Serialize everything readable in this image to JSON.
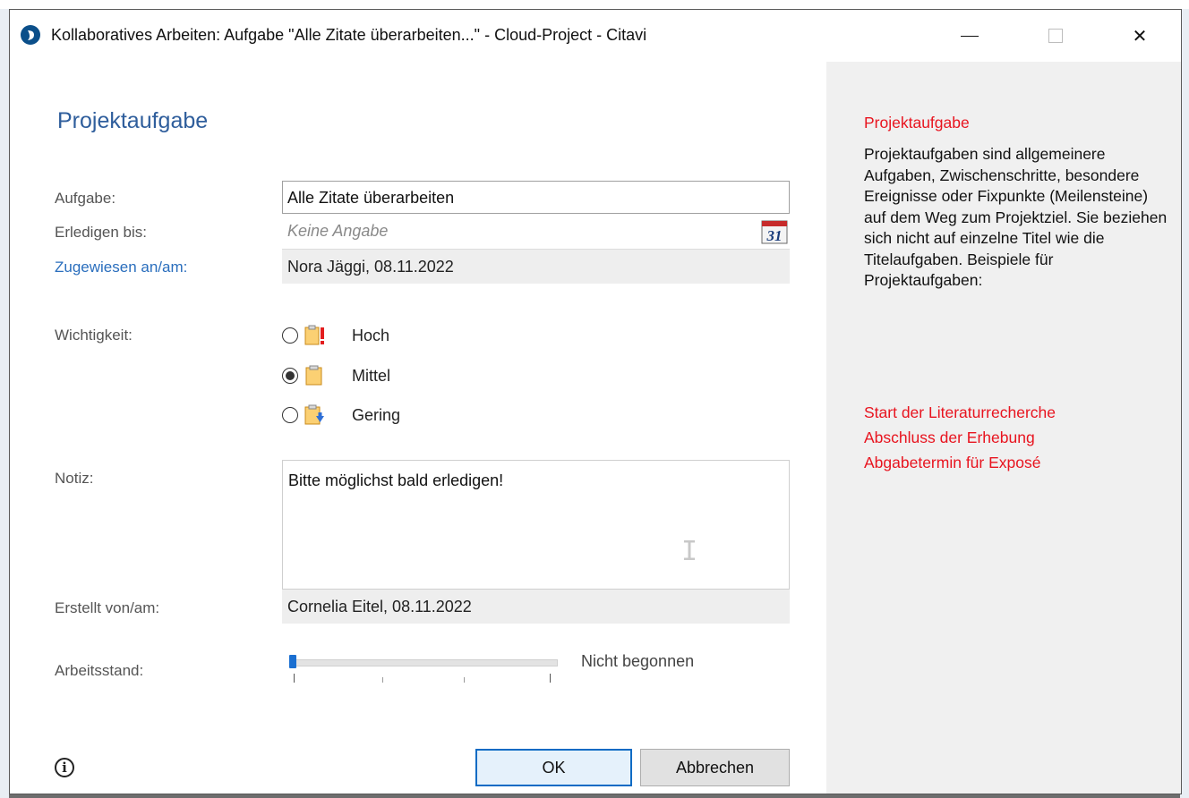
{
  "window": {
    "title": "Kollaboratives Arbeiten: Aufgabe \"Alle Zitate überarbeiten...\" - Cloud-Project - Citavi",
    "minimize_glyph": "—",
    "close_glyph": "✕"
  },
  "form": {
    "heading": "Projektaufgabe",
    "task_label": "Aufgabe:",
    "task_value": "Alle Zitate überarbeiten",
    "due_label": "Erledigen bis:",
    "due_placeholder": "Keine Angabe",
    "calendar_day": "31",
    "assigned_label": "Zugewiesen an/am:",
    "assigned_value": "Nora Jäggi, 08.11.2022",
    "priority_label": "Wichtigkeit:",
    "priority_options": [
      {
        "label": "Hoch",
        "selected": false,
        "icon": "task-high-icon"
      },
      {
        "label": "Mittel",
        "selected": true,
        "icon": "task-medium-icon"
      },
      {
        "label": "Gering",
        "selected": false,
        "icon": "task-low-icon"
      }
    ],
    "note_label": "Notiz:",
    "note_value": "Bitte möglichst bald erledigen!",
    "created_label": "Erstellt von/am:",
    "created_value": "Cornelia Eitel, 08.11.2022",
    "progress_label": "Arbeitsstand:",
    "progress_value_text": "Nicht begonnen",
    "progress_fraction": 0
  },
  "buttons": {
    "info_glyph": "i",
    "ok": "OK",
    "cancel": "Abbrechen"
  },
  "help": {
    "title": "Projektaufgabe",
    "body": "Projektaufgaben sind allgemeinere Aufgaben, Zwischenschritte, besondere Ereignisse oder Fixpunkte (Meilensteine) auf dem Weg zum Projektziel. Sie beziehen sich nicht auf einzelne Titel wie die Titelaufgaben. Beispiele für Projektaufgaben:",
    "examples": [
      "Start der Literaturrecherche",
      "Abschluss der Erhebung",
      "Abgabetermin für Exposé"
    ]
  },
  "colors": {
    "heading_blue": "#2f5e9c",
    "link_blue": "#2a6ebd",
    "help_red": "#e8141f",
    "right_pane_bg": "#f0f0f0",
    "ok_border": "#0b6bc4"
  }
}
